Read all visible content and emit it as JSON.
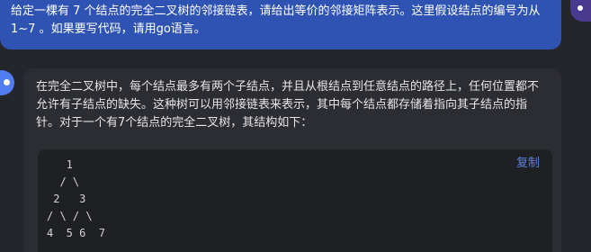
{
  "user_message": {
    "text": "给定一棵有 7 个结点的完全二叉树的邻接链表，请给出等价的邻接矩阵表示。这里假设结点的编号为从 1~7 。如果要写代码，请用go语言。"
  },
  "assistant_message": {
    "text": "在完全二叉树中，每个结点最多有两个子结点，并且从根结点到任意结点的路径上，任何位置都不允许有子结点的缺失。这种树可以用邻接链表来表示，其中每个结点都存储着指向其子结点的指针。对于一个有7个结点的完全二叉树，其结构如下：",
    "code_block": {
      "copy_label": "复制",
      "code": "   1\n  / \\\n 2   3\n/ \\ / \\\n4  5 6  7"
    }
  },
  "colors": {
    "background": "#25262b",
    "user_bubble": "#2f53b3",
    "assistant_bubble": "#2c2d33",
    "code_background": "#1f2024",
    "copy_link": "#5a83d8"
  }
}
